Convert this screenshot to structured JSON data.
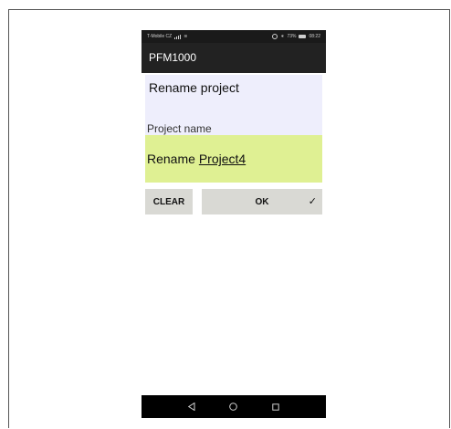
{
  "status_bar": {
    "carrier": "T-Mobile CZ",
    "battery": "73%",
    "time": "08:22"
  },
  "app_bar": {
    "title": "PFM1000"
  },
  "dialog": {
    "title": "Rename project",
    "field_label": "Project name",
    "input_prefix": "Rename ",
    "input_value": "Project4"
  },
  "buttons": {
    "clear_label": "CLEAR",
    "ok_label": "OK",
    "ok_icon": "check-icon"
  },
  "nav": {
    "back_icon": "back-triangle-icon",
    "home_icon": "home-circle-icon",
    "recent_icon": "recent-square-icon"
  },
  "colors": {
    "app_bar": "#222222",
    "title_area": "#eeeefc",
    "input_area": "#dff093",
    "button": "#d9d9d4"
  }
}
